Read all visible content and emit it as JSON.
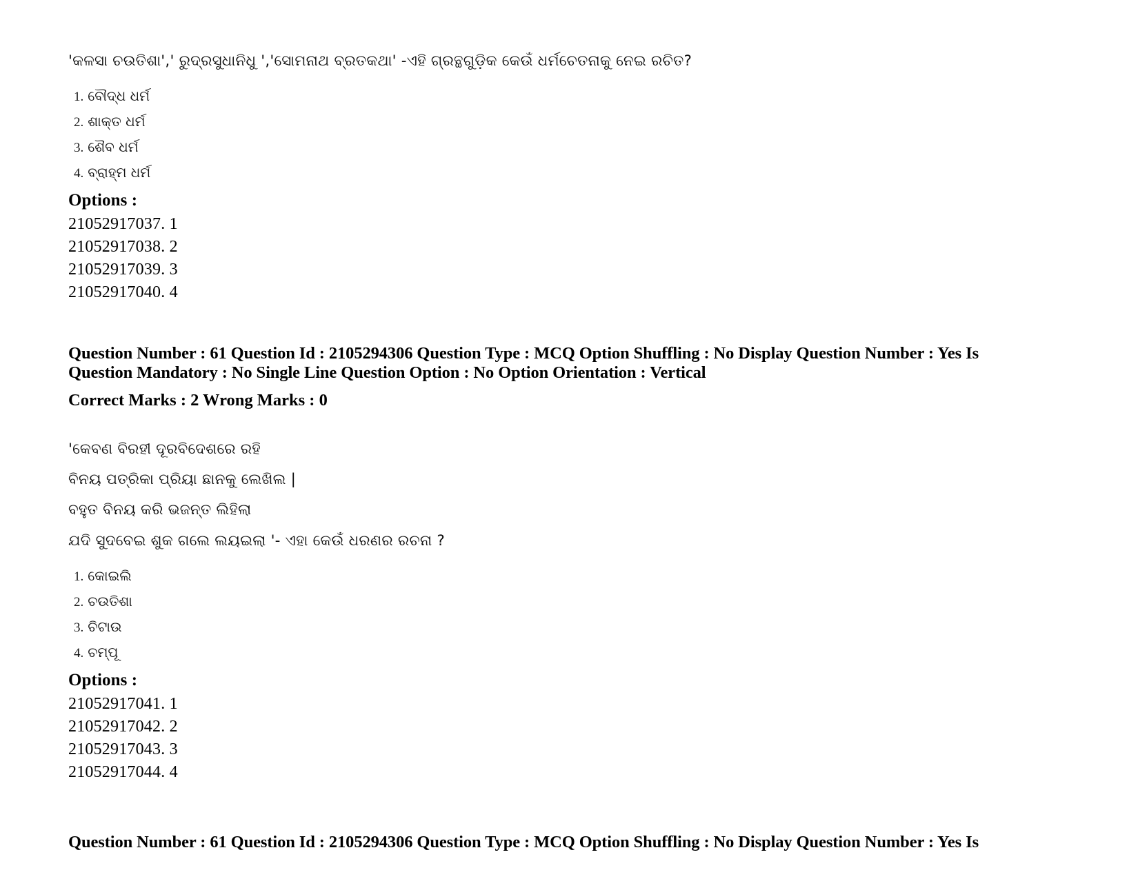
{
  "document": {
    "type": "exam-question-paper",
    "page_background": "#ffffff",
    "text_color": "#000000"
  },
  "question_60": {
    "stem_odia": "'କଳସା ଚଉତିଶା','  ରୁଦ୍ରସୁଧାନିଧୁ   ','ସୋମନାଥ ବ୍ରତକଥା' -ଏହି ଗ୍ରନ୍ଥଗୁଡ଼ିକ କେଉଁ ଧର୍ମଚେତନାକୁ ନେଇ ରଚିତ?",
    "choices": [
      {
        "num": "1.",
        "text": "ବୌଦ୍ଧ ଧର୍ମ"
      },
      {
        "num": "2.",
        "text": "ଶାକ୍ତ ଧର୍ମ"
      },
      {
        "num": "3.",
        "text": "ଶୈବ ଧର୍ମ"
      },
      {
        "num": "4.",
        "text": "ବ୍ରାହ୍ମ ଧର୍ମ"
      }
    ],
    "options_label": "Options :",
    "option_ids": [
      "21052917037. 1",
      "21052917038. 2",
      "21052917039. 3",
      "21052917040. 4"
    ]
  },
  "meta_block_1": {
    "line1": "Question Number : 61 Question Id : 2105294306 Question Type : MCQ Option Shuffling : No Display Question Number : Yes Is",
    "line2": "Question Mandatory : No Single Line Question Option : No Option Orientation : Vertical",
    "marks": "Correct Marks : 2 Wrong Marks : 0"
  },
  "question_61": {
    "stem_lines": [
      "'କେବଣ ବିରହୀ ଦୂରବିଦେଶରେ ରହି",
      "ବିନୟ ପତ୍ରିକା ପ୍ରିୟା ଛାନକୁ ଲେଖିଲ |",
      "ବହୁତ ବିନୟ କରି  ଭଜନ୍ତ ଲିହିଲା",
      "ଯଦି ସୁଦବେଇ ଶୁକ ଗଲେ ଲୟଇଲା '- ଏହା କେଉଁ ଧରଣର ରଚନା ?"
    ],
    "choices": [
      {
        "num": "1.",
        "text": "କୋଇଲି"
      },
      {
        "num": "2.",
        "text": "ଚଉତିଶା"
      },
      {
        "num": "3.",
        "text": "ଚିଟାଉ"
      },
      {
        "num": "4.",
        "text": "ଚମ୍ପୂ"
      }
    ],
    "options_label": "Options :",
    "option_ids": [
      "21052917041. 1",
      "21052917042. 2",
      "21052917043. 3",
      "21052917044. 4"
    ]
  },
  "meta_block_2": {
    "line1": "Question Number : 61 Question Id : 2105294306 Question Type : MCQ Option Shuffling : No Display Question Number : Yes Is"
  }
}
